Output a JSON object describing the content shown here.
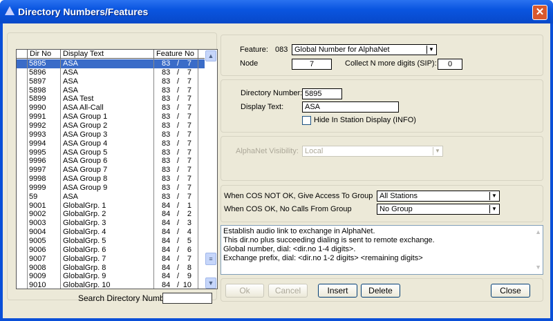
{
  "window": {
    "title": "Directory Numbers/Features",
    "close_glyph": "✕"
  },
  "list": {
    "columns": [
      "Dir No",
      "Display Text",
      "Feature No"
    ],
    "selected_index": 0,
    "rows": [
      [
        "5895",
        "ASA",
        "83",
        "7"
      ],
      [
        "5896",
        "ASA",
        "83",
        "7"
      ],
      [
        "5897",
        "ASA",
        "83",
        "7"
      ],
      [
        "5898",
        "ASA",
        "83",
        "7"
      ],
      [
        "5899",
        "ASA Test",
        "83",
        "7"
      ],
      [
        "9990",
        "ASA All-Call",
        "83",
        "7"
      ],
      [
        "9991",
        "ASA Group 1",
        "83",
        "7"
      ],
      [
        "9992",
        "ASA Group 2",
        "83",
        "7"
      ],
      [
        "9993",
        "ASA Group 3",
        "83",
        "7"
      ],
      [
        "9994",
        "ASA Group 4",
        "83",
        "7"
      ],
      [
        "9995",
        "ASA Group 5",
        "83",
        "7"
      ],
      [
        "9996",
        "ASA Group 6",
        "83",
        "7"
      ],
      [
        "9997",
        "ASA Group 7",
        "83",
        "7"
      ],
      [
        "9998",
        "ASA Group 8",
        "83",
        "7"
      ],
      [
        "9999",
        "ASA Group 9",
        "83",
        "7"
      ],
      [
        "59",
        "ASA",
        "83",
        "7"
      ],
      [
        "9001",
        "GlobalGrp. 1",
        "84",
        "1"
      ],
      [
        "9002",
        "GlobalGrp. 2",
        "84",
        "2"
      ],
      [
        "9003",
        "GlobalGrp. 3",
        "84",
        "3"
      ],
      [
        "9004",
        "GlobalGrp. 4",
        "84",
        "4"
      ],
      [
        "9005",
        "GlobalGrp. 5",
        "84",
        "5"
      ],
      [
        "9006",
        "GlobalGrp. 6",
        "84",
        "6"
      ],
      [
        "9007",
        "GlobalGrp. 7",
        "84",
        "7"
      ],
      [
        "9008",
        "GlobalGrp. 8",
        "84",
        "8"
      ],
      [
        "9009",
        "GlobalGrp. 9",
        "84",
        "9"
      ],
      [
        "9010",
        "GlobalGrp. 10",
        "84",
        "10"
      ]
    ],
    "search_label": "Search Directory Number:",
    "search_value": ""
  },
  "feature": {
    "label": "Feature:",
    "code": "083",
    "value": "Global Number for AlphaNet",
    "node_label": "Node",
    "node_value": "7",
    "collect_label": "Collect N more digits (SIP):",
    "collect_value": "0"
  },
  "entry": {
    "dirno_label": "Directory Number:",
    "dirno_value": "5895",
    "display_label": "Display Text:",
    "display_value": "ASA",
    "hide_label": "Hide In Station Display (INFO)",
    "hide_checked": false
  },
  "alphanet": {
    "label": "AlphaNet Visibility:",
    "value": "Local"
  },
  "cos": {
    "not_ok_label": "When COS NOT OK, Give Access To Group",
    "not_ok_value": "All Stations",
    "ok_label": "When COS OK, No Calls From Group",
    "ok_value": "No Group"
  },
  "description": [
    "Establish audio link to exchange in AlphaNet.",
    "This dir.no plus succeeding dialing is sent to remote exchange.",
    "Global number, dial: <dir.no 1-4 digits>.",
    "Exchange prefix, dial: <dir.no 1-2 digits> <remaining digits>"
  ],
  "buttons": {
    "ok": "Ok",
    "cancel": "Cancel",
    "insert": "Insert",
    "delete": "Delete",
    "close": "Close"
  }
}
